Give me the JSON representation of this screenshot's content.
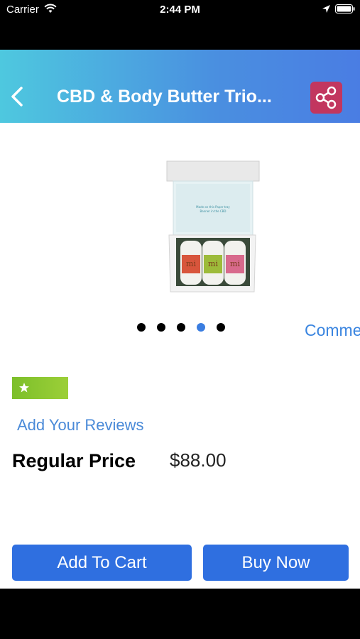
{
  "status_bar": {
    "carrier": "Carrier",
    "time": "2:44 PM"
  },
  "nav": {
    "title": "CBD & Body Butter Trio...",
    "back_icon": "chevron-left-icon",
    "share_icon": "share-icon",
    "share_color": "#c2365f"
  },
  "product": {
    "image_icon": "product-box-image",
    "pager": {
      "total": 5,
      "active_index": 3
    },
    "comments_label": "Comme",
    "rating_icon": "star-icon",
    "add_review_label": "Add Your Reviews",
    "price_label": "Regular Price",
    "price_value": "$88.00"
  },
  "actions": {
    "add_to_cart": "Add To Cart",
    "buy_now": "Buy Now",
    "button_color": "#2f6fe0"
  }
}
